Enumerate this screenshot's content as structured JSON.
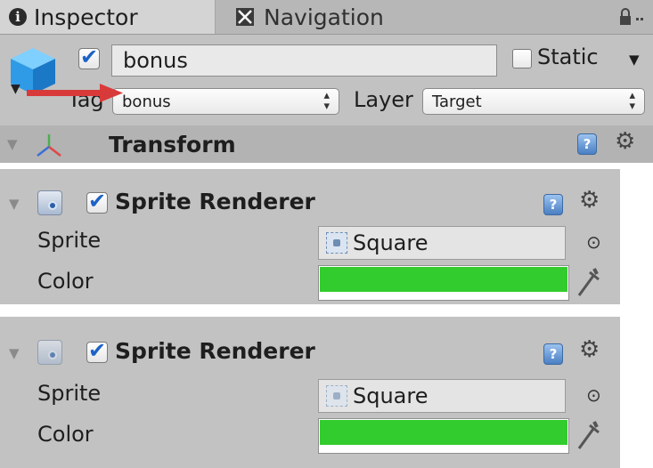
{
  "tabs": [
    {
      "label": "Inspector",
      "icon": "info-icon",
      "active": true
    },
    {
      "label": "Navigation",
      "icon": "navigation-icon",
      "active": false
    }
  ],
  "object": {
    "active": true,
    "name": "bonus",
    "static_label": "Static",
    "static_checked": false,
    "tag_label": "Tag",
    "tag_value": "bonus",
    "layer_label": "Layer",
    "layer_value": "Target"
  },
  "transform": {
    "title": "Transform"
  },
  "sprite_renderers": [
    {
      "title": "Sprite Renderer",
      "enabled": true,
      "sprite_label": "Sprite",
      "sprite_value": "Square",
      "color_label": "Color",
      "color": "#33cc2e"
    },
    {
      "title": "Sprite Renderer",
      "enabled": true,
      "sprite_label": "Sprite",
      "sprite_value": "Square",
      "color_label": "Color",
      "color": "#33cc2e"
    }
  ],
  "colors": {
    "annotation_arrow": "#d83a3a",
    "help_icon": "#4a7fc3",
    "checkbox_tick": "#1c62c7"
  }
}
